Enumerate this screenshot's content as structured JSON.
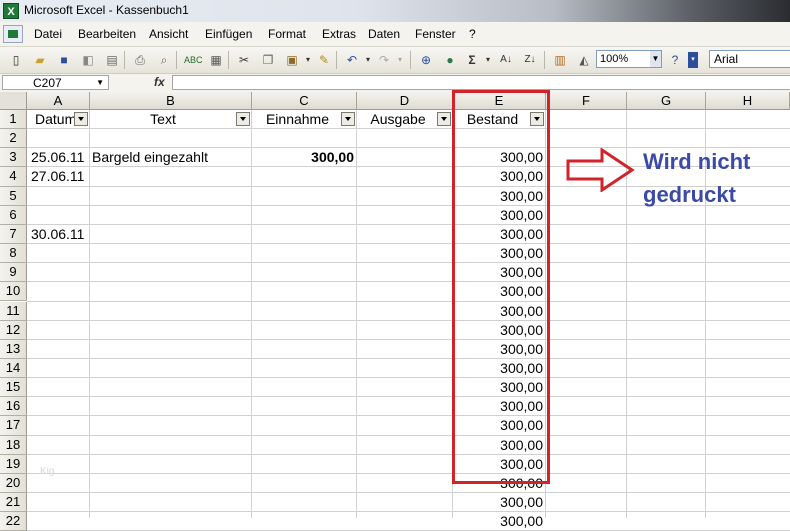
{
  "window": {
    "title": "Microsoft Excel - Kassenbuch1",
    "app_icon": "X"
  },
  "menu": [
    "Datei",
    "Bearbeiten",
    "Ansicht",
    "Einfügen",
    "Format",
    "Extras",
    "Daten",
    "Fenster",
    "?"
  ],
  "toolbar": {
    "zoom": "100%",
    "font": "Arial",
    "icons": [
      "new-icon",
      "open-icon",
      "save-icon",
      "permission-icon",
      "print-icon",
      "print-preview-icon",
      "spelling-icon",
      "research-icon",
      "cut-icon",
      "copy-icon",
      "paste-icon",
      "format-painter-icon",
      "undo-icon",
      "redo-icon",
      "hyperlink-icon",
      "autosum-icon",
      "sort-ascending-icon",
      "sort-descending-icon",
      "chart-wizard-icon",
      "drawing-icon",
      "help-icon"
    ],
    "autosum_glyph": "Σ"
  },
  "formula_bar": {
    "name_box": "C207",
    "fx": "fx",
    "value": ""
  },
  "columns": [
    "A",
    "B",
    "C",
    "D",
    "E",
    "F",
    "G",
    "H"
  ],
  "row_numbers": [
    "1",
    "2",
    "3",
    "4",
    "5",
    "6",
    "7",
    "8",
    "9",
    "10",
    "11",
    "12",
    "13",
    "14",
    "15",
    "16",
    "17",
    "18",
    "19",
    "20",
    "21",
    "22"
  ],
  "headers": {
    "a": "Datum",
    "b": "Text",
    "c": "Einnahme",
    "d": "Ausgabe",
    "e": "Bestand"
  },
  "rows": [
    {
      "a": "",
      "b": "",
      "c": "",
      "e": ""
    },
    {
      "a": "25.06.11",
      "b": "Bargeld eingezahlt",
      "c": "300,00",
      "e": "300,00"
    },
    {
      "a": "27.06.11",
      "b": "",
      "c": "",
      "e": "300,00"
    },
    {
      "a": "",
      "b": "",
      "c": "",
      "e": "300,00"
    },
    {
      "a": "",
      "b": "",
      "c": "",
      "e": "300,00"
    },
    {
      "a": "30.06.11",
      "b": "",
      "c": "",
      "e": "300,00"
    },
    {
      "a": "",
      "b": "",
      "c": "",
      "e": "300,00"
    },
    {
      "a": "",
      "b": "",
      "c": "",
      "e": "300,00"
    },
    {
      "a": "",
      "b": "",
      "c": "",
      "e": "300,00"
    },
    {
      "a": "",
      "b": "",
      "c": "",
      "e": "300,00"
    },
    {
      "a": "",
      "b": "",
      "c": "",
      "e": "300,00"
    },
    {
      "a": "",
      "b": "",
      "c": "",
      "e": "300,00"
    },
    {
      "a": "",
      "b": "",
      "c": "",
      "e": "300,00"
    },
    {
      "a": "",
      "b": "",
      "c": "",
      "e": "300,00"
    },
    {
      "a": "",
      "b": "",
      "c": "",
      "e": "300,00"
    },
    {
      "a": "",
      "b": "",
      "c": "",
      "e": "300,00"
    },
    {
      "a": "",
      "b": "",
      "c": "",
      "e": "300,00"
    },
    {
      "a": "",
      "b": "",
      "c": "",
      "e": "300,00"
    },
    {
      "a": "",
      "b": "",
      "c": "",
      "e": "300,00"
    },
    {
      "a": "",
      "b": "",
      "c": "",
      "e": "300,00"
    },
    {
      "a": "",
      "b": "",
      "c": "",
      "e": "300,00"
    }
  ],
  "annotation": {
    "line1": "Wird nicht",
    "line2": "gedruckt",
    "color": "#3b4aa8",
    "box_color": "#d2222a"
  },
  "watermark": "Kig"
}
